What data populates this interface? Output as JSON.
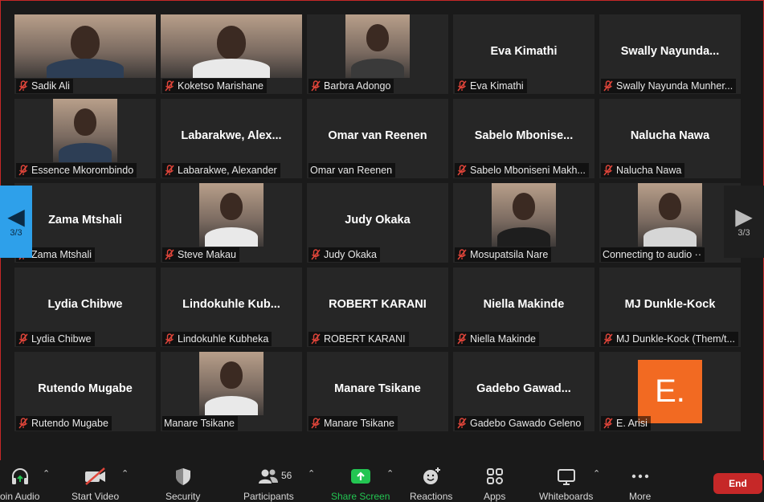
{
  "participants": [
    {
      "center": "",
      "label": "Sadik Ali",
      "muted": true,
      "video": "full"
    },
    {
      "center": "",
      "label": "Koketso Marishane",
      "muted": true,
      "video": "full"
    },
    {
      "center": "",
      "label": "Barbra Adongo",
      "muted": true,
      "video": "small"
    },
    {
      "center": "Eva Kimathi",
      "label": "Eva Kimathi",
      "muted": true,
      "video": "none"
    },
    {
      "center": "Swally  Nayunda...",
      "label": "Swally Nayunda Munher...",
      "muted": true,
      "video": "none"
    },
    {
      "center": "",
      "label": "Essence Mkorombindo",
      "muted": true,
      "video": "small"
    },
    {
      "center": "Labarakwe,  Alex...",
      "label": "Labarakwe, Alexander",
      "muted": true,
      "video": "none"
    },
    {
      "center": "Omar van Reenen",
      "label": "Omar van Reenen",
      "muted": false,
      "video": "none"
    },
    {
      "center": "Sabelo  Mbonise...",
      "label": "Sabelo Mboniseni Makh...",
      "muted": true,
      "video": "none"
    },
    {
      "center": "Nalucha Nawa",
      "label": "Nalucha Nawa",
      "muted": true,
      "video": "none"
    },
    {
      "center": "Zama Mtshali",
      "label": "Zama Mtshali",
      "muted": true,
      "video": "none"
    },
    {
      "center": "",
      "label": "Steve Makau",
      "muted": true,
      "video": "small"
    },
    {
      "center": "Judy Okaka",
      "label": "Judy Okaka",
      "muted": true,
      "video": "none"
    },
    {
      "center": "",
      "label": "Mosupatsila Nare",
      "muted": true,
      "video": "small"
    },
    {
      "center": "",
      "label": "Connecting to audio ··",
      "muted": false,
      "video": "small"
    },
    {
      "center": "Lydia Chibwe",
      "label": "Lydia Chibwe",
      "muted": true,
      "video": "none"
    },
    {
      "center": "Lindokuhle  Kub...",
      "label": "Lindokuhle Kubheka",
      "muted": true,
      "video": "none"
    },
    {
      "center": "ROBERT KARANI",
      "label": "ROBERT KARANI",
      "muted": true,
      "video": "none"
    },
    {
      "center": "Niella Makinde",
      "label": "Niella Makinde",
      "muted": true,
      "video": "none"
    },
    {
      "center": "MJ Dunkle-Kock",
      "label": "MJ Dunkle-Kock (Them/t...",
      "muted": true,
      "video": "none"
    },
    {
      "center": "Rutendo Mugabe",
      "label": "Rutendo Mugabe",
      "muted": true,
      "video": "none"
    },
    {
      "center": "",
      "label": "Manare Tsikane",
      "muted": false,
      "video": "small"
    },
    {
      "center": "Manare Tsikane",
      "label": "Manare Tsikane",
      "muted": true,
      "video": "none"
    },
    {
      "center": "Gadebo  Gawad...",
      "label": "Gadebo Gawado Geleno",
      "muted": true,
      "video": "none"
    },
    {
      "center": "",
      "label": "E. Arisi",
      "muted": true,
      "video": "avatar",
      "avatar_text": "E."
    }
  ],
  "pagination": {
    "left": "3/3",
    "right": "3/3"
  },
  "toolbar": {
    "join_audio": "oin Audio",
    "start_video": "Start Video",
    "security": "Security",
    "participants": "Participants",
    "participants_count": "56",
    "share_screen": "Share Screen",
    "reactions": "Reactions",
    "apps": "Apps",
    "whiteboards": "Whiteboards",
    "more": "More",
    "end": "End"
  },
  "colors": {
    "background": "#1a1a1a",
    "tile": "#262626",
    "muted_icon": "#e0453a",
    "share_green": "#23c552",
    "end_red": "#c62828",
    "nav_blue": "#2ea0ea",
    "avatar_orange": "#f26a22"
  },
  "icons": [
    "muted-mic-icon",
    "headphone-icon",
    "video-off-icon",
    "shield-icon",
    "participants-icon",
    "share-arrow-icon",
    "reaction-icon",
    "apps-icon",
    "whiteboard-icon",
    "more-dots-icon",
    "chevron-left-icon",
    "chevron-right-icon",
    "caret-up-icon"
  ]
}
